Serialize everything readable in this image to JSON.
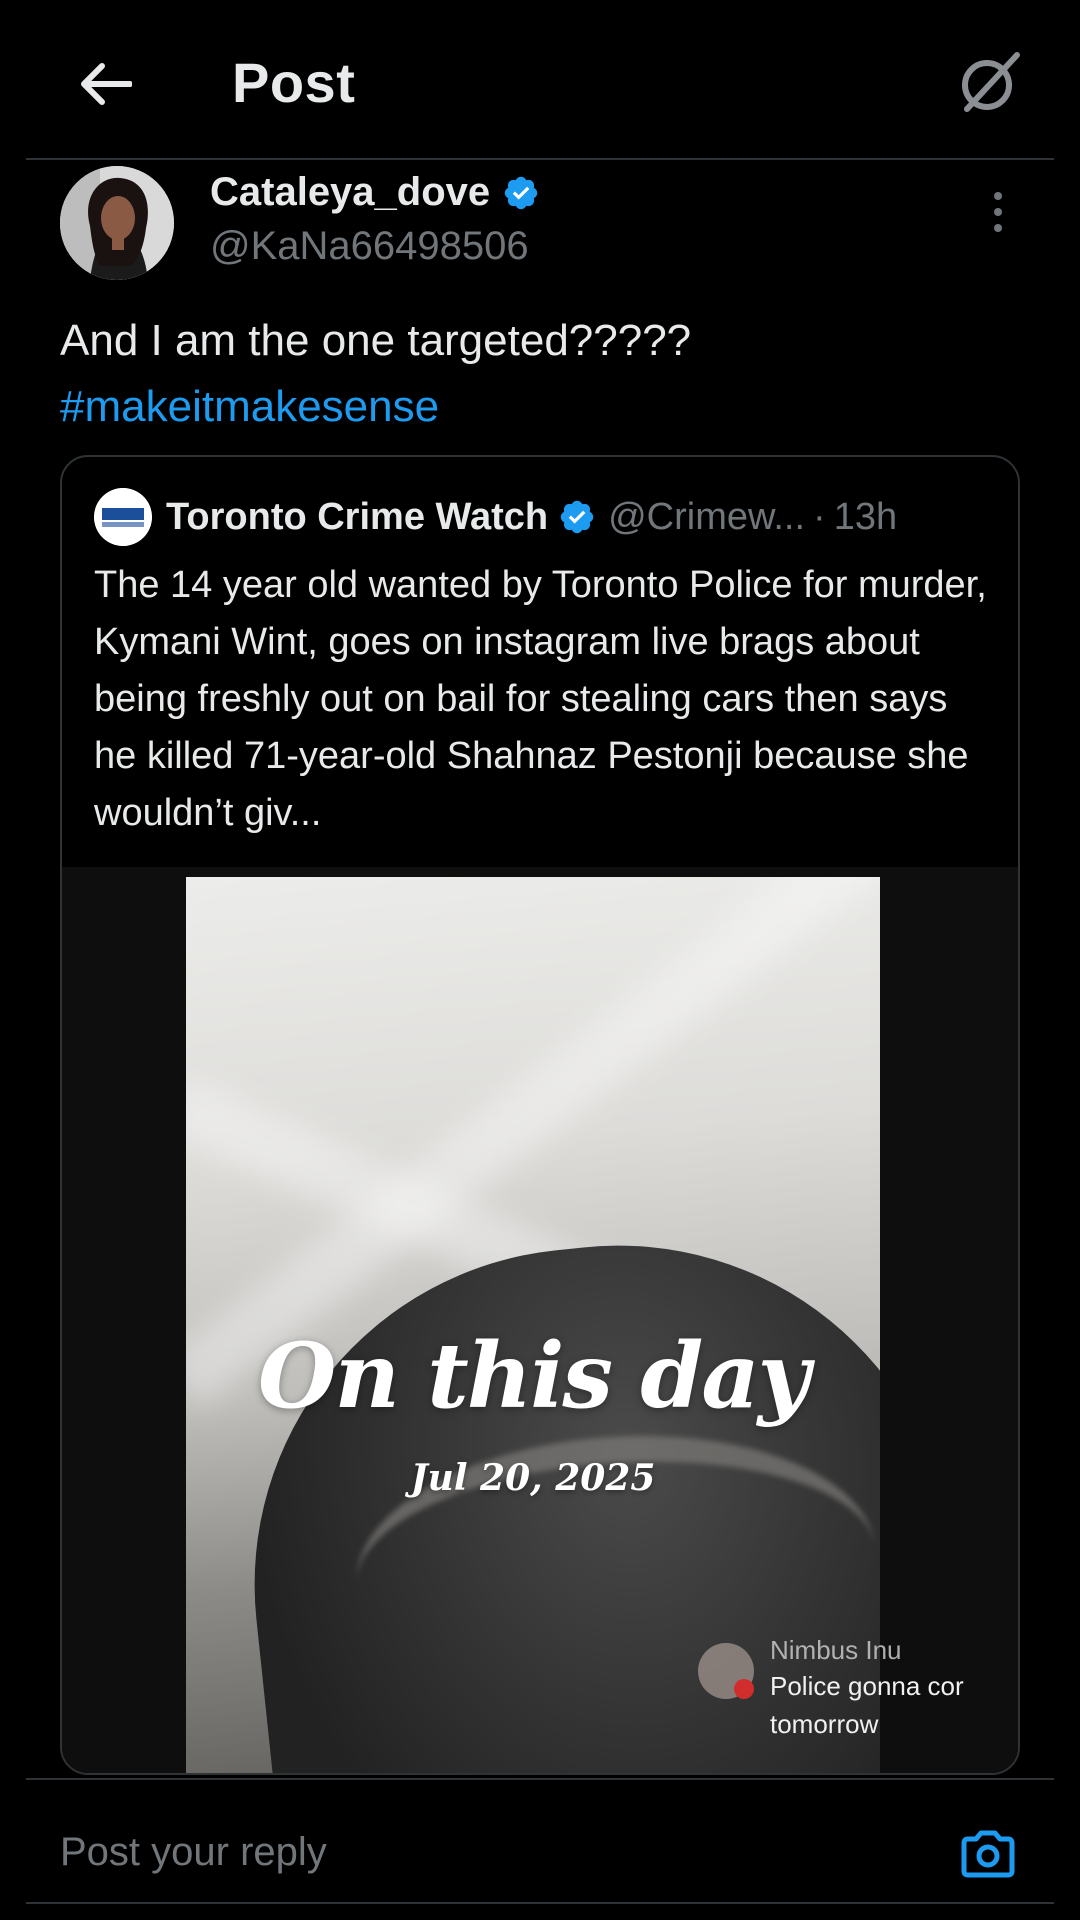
{
  "header": {
    "title": "Post",
    "back_icon": "arrow-left-icon",
    "grok_icon": "grok-icon"
  },
  "post": {
    "author": {
      "display_name": "Cataleya_dove",
      "handle": "@KaNa66498506",
      "verified": true
    },
    "text": "And I am the one targeted?????",
    "hashtag": "#makeitmakesense"
  },
  "quoted": {
    "display_name": "Toronto Crime Watch",
    "handle": "@Crimew...",
    "time_sep": "·",
    "time": "13h",
    "verified": true,
    "avatar_label": "Toronto",
    "text": "The 14 year old wanted by Toronto Police for murder, Kymani Wint, goes on instagram live brags about being freshly out on bail for stealing cars then says he killed 71-year-old Shahnaz Pestonji because she wouldn’t giv...",
    "media": {
      "overlay_title": "On this day",
      "overlay_date": "Jul 20, 2025",
      "live_comment": {
        "user": "Nimbus Inu",
        "message_line1": "Police gonna cor",
        "message_line2": "tomorrow"
      }
    }
  },
  "reply": {
    "placeholder": "Post your reply",
    "camera_icon": "camera-icon"
  },
  "colors": {
    "background": "#000000",
    "text_primary": "#e7e9ea",
    "text_secondary": "#71767b",
    "accent": "#1d9bf0",
    "border": "#2f3336"
  }
}
